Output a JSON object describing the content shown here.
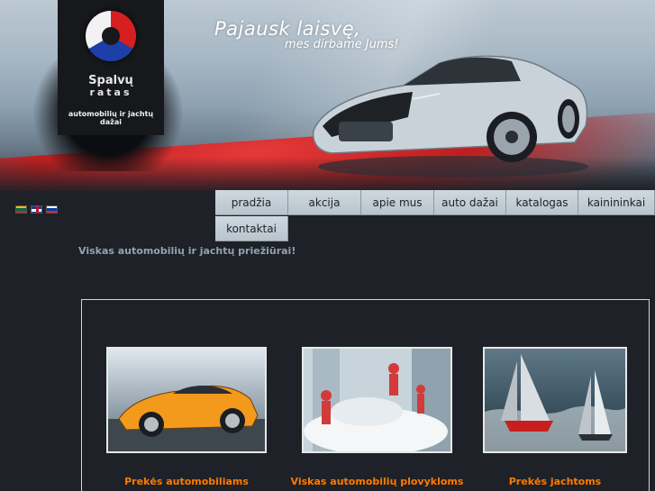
{
  "header": {
    "logo_line1": "Spalvų",
    "logo_line2": "ratas",
    "logo_tagline": "automobilių ir jachtų dažai",
    "slogan_line1": "Pajausk laisvę,",
    "slogan_line2": "mes dirbame Jums!"
  },
  "languages": [
    {
      "code": "lt",
      "icon": "lithuania-flag-icon"
    },
    {
      "code": "en",
      "icon": "uk-flag-icon"
    },
    {
      "code": "ru",
      "icon": "russia-flag-icon"
    }
  ],
  "nav": {
    "items": [
      "pradžia",
      "akcija",
      "apie mus",
      "auto dažai",
      "katalogas",
      "kainininkai",
      "kontaktai"
    ]
  },
  "tagline": "Viskas automobilių ir jachtų priežiūrai!",
  "products": [
    {
      "caption": "Prekės automobiliams",
      "image": "orange-sports-car"
    },
    {
      "caption": "Viskas automobilių plovykloms",
      "image": "car-wash-foam"
    },
    {
      "caption": "Prekės jachtoms",
      "image": "racing-yachts"
    }
  ],
  "colors": {
    "background": "#1e2127",
    "nav_button": "#c3cdd5",
    "caption": "#ff7a00",
    "tagline": "#8fa3b2",
    "accent_red": "#c01e1e"
  }
}
